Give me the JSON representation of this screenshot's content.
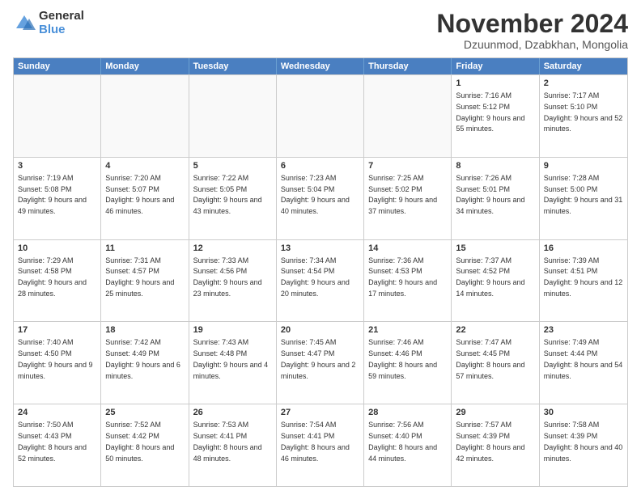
{
  "logo": {
    "general": "General",
    "blue": "Blue"
  },
  "header": {
    "month": "November 2024",
    "location": "Dzuunmod, Dzabkhan, Mongolia"
  },
  "weekdays": [
    "Sunday",
    "Monday",
    "Tuesday",
    "Wednesday",
    "Thursday",
    "Friday",
    "Saturday"
  ],
  "rows": [
    [
      {
        "day": "",
        "sunrise": "",
        "sunset": "",
        "daylight": "",
        "empty": true
      },
      {
        "day": "",
        "sunrise": "",
        "sunset": "",
        "daylight": "",
        "empty": true
      },
      {
        "day": "",
        "sunrise": "",
        "sunset": "",
        "daylight": "",
        "empty": true
      },
      {
        "day": "",
        "sunrise": "",
        "sunset": "",
        "daylight": "",
        "empty": true
      },
      {
        "day": "",
        "sunrise": "",
        "sunset": "",
        "daylight": "",
        "empty": true
      },
      {
        "day": "1",
        "sunrise": "Sunrise: 7:16 AM",
        "sunset": "Sunset: 5:12 PM",
        "daylight": "Daylight: 9 hours and 55 minutes.",
        "empty": false
      },
      {
        "day": "2",
        "sunrise": "Sunrise: 7:17 AM",
        "sunset": "Sunset: 5:10 PM",
        "daylight": "Daylight: 9 hours and 52 minutes.",
        "empty": false
      }
    ],
    [
      {
        "day": "3",
        "sunrise": "Sunrise: 7:19 AM",
        "sunset": "Sunset: 5:08 PM",
        "daylight": "Daylight: 9 hours and 49 minutes.",
        "empty": false
      },
      {
        "day": "4",
        "sunrise": "Sunrise: 7:20 AM",
        "sunset": "Sunset: 5:07 PM",
        "daylight": "Daylight: 9 hours and 46 minutes.",
        "empty": false
      },
      {
        "day": "5",
        "sunrise": "Sunrise: 7:22 AM",
        "sunset": "Sunset: 5:05 PM",
        "daylight": "Daylight: 9 hours and 43 minutes.",
        "empty": false
      },
      {
        "day": "6",
        "sunrise": "Sunrise: 7:23 AM",
        "sunset": "Sunset: 5:04 PM",
        "daylight": "Daylight: 9 hours and 40 minutes.",
        "empty": false
      },
      {
        "day": "7",
        "sunrise": "Sunrise: 7:25 AM",
        "sunset": "Sunset: 5:02 PM",
        "daylight": "Daylight: 9 hours and 37 minutes.",
        "empty": false
      },
      {
        "day": "8",
        "sunrise": "Sunrise: 7:26 AM",
        "sunset": "Sunset: 5:01 PM",
        "daylight": "Daylight: 9 hours and 34 minutes.",
        "empty": false
      },
      {
        "day": "9",
        "sunrise": "Sunrise: 7:28 AM",
        "sunset": "Sunset: 5:00 PM",
        "daylight": "Daylight: 9 hours and 31 minutes.",
        "empty": false
      }
    ],
    [
      {
        "day": "10",
        "sunrise": "Sunrise: 7:29 AM",
        "sunset": "Sunset: 4:58 PM",
        "daylight": "Daylight: 9 hours and 28 minutes.",
        "empty": false
      },
      {
        "day": "11",
        "sunrise": "Sunrise: 7:31 AM",
        "sunset": "Sunset: 4:57 PM",
        "daylight": "Daylight: 9 hours and 25 minutes.",
        "empty": false
      },
      {
        "day": "12",
        "sunrise": "Sunrise: 7:33 AM",
        "sunset": "Sunset: 4:56 PM",
        "daylight": "Daylight: 9 hours and 23 minutes.",
        "empty": false
      },
      {
        "day": "13",
        "sunrise": "Sunrise: 7:34 AM",
        "sunset": "Sunset: 4:54 PM",
        "daylight": "Daylight: 9 hours and 20 minutes.",
        "empty": false
      },
      {
        "day": "14",
        "sunrise": "Sunrise: 7:36 AM",
        "sunset": "Sunset: 4:53 PM",
        "daylight": "Daylight: 9 hours and 17 minutes.",
        "empty": false
      },
      {
        "day": "15",
        "sunrise": "Sunrise: 7:37 AM",
        "sunset": "Sunset: 4:52 PM",
        "daylight": "Daylight: 9 hours and 14 minutes.",
        "empty": false
      },
      {
        "day": "16",
        "sunrise": "Sunrise: 7:39 AM",
        "sunset": "Sunset: 4:51 PM",
        "daylight": "Daylight: 9 hours and 12 minutes.",
        "empty": false
      }
    ],
    [
      {
        "day": "17",
        "sunrise": "Sunrise: 7:40 AM",
        "sunset": "Sunset: 4:50 PM",
        "daylight": "Daylight: 9 hours and 9 minutes.",
        "empty": false
      },
      {
        "day": "18",
        "sunrise": "Sunrise: 7:42 AM",
        "sunset": "Sunset: 4:49 PM",
        "daylight": "Daylight: 9 hours and 6 minutes.",
        "empty": false
      },
      {
        "day": "19",
        "sunrise": "Sunrise: 7:43 AM",
        "sunset": "Sunset: 4:48 PM",
        "daylight": "Daylight: 9 hours and 4 minutes.",
        "empty": false
      },
      {
        "day": "20",
        "sunrise": "Sunrise: 7:45 AM",
        "sunset": "Sunset: 4:47 PM",
        "daylight": "Daylight: 9 hours and 2 minutes.",
        "empty": false
      },
      {
        "day": "21",
        "sunrise": "Sunrise: 7:46 AM",
        "sunset": "Sunset: 4:46 PM",
        "daylight": "Daylight: 8 hours and 59 minutes.",
        "empty": false
      },
      {
        "day": "22",
        "sunrise": "Sunrise: 7:47 AM",
        "sunset": "Sunset: 4:45 PM",
        "daylight": "Daylight: 8 hours and 57 minutes.",
        "empty": false
      },
      {
        "day": "23",
        "sunrise": "Sunrise: 7:49 AM",
        "sunset": "Sunset: 4:44 PM",
        "daylight": "Daylight: 8 hours and 54 minutes.",
        "empty": false
      }
    ],
    [
      {
        "day": "24",
        "sunrise": "Sunrise: 7:50 AM",
        "sunset": "Sunset: 4:43 PM",
        "daylight": "Daylight: 8 hours and 52 minutes.",
        "empty": false
      },
      {
        "day": "25",
        "sunrise": "Sunrise: 7:52 AM",
        "sunset": "Sunset: 4:42 PM",
        "daylight": "Daylight: 8 hours and 50 minutes.",
        "empty": false
      },
      {
        "day": "26",
        "sunrise": "Sunrise: 7:53 AM",
        "sunset": "Sunset: 4:41 PM",
        "daylight": "Daylight: 8 hours and 48 minutes.",
        "empty": false
      },
      {
        "day": "27",
        "sunrise": "Sunrise: 7:54 AM",
        "sunset": "Sunset: 4:41 PM",
        "daylight": "Daylight: 8 hours and 46 minutes.",
        "empty": false
      },
      {
        "day": "28",
        "sunrise": "Sunrise: 7:56 AM",
        "sunset": "Sunset: 4:40 PM",
        "daylight": "Daylight: 8 hours and 44 minutes.",
        "empty": false
      },
      {
        "day": "29",
        "sunrise": "Sunrise: 7:57 AM",
        "sunset": "Sunset: 4:39 PM",
        "daylight": "Daylight: 8 hours and 42 minutes.",
        "empty": false
      },
      {
        "day": "30",
        "sunrise": "Sunrise: 7:58 AM",
        "sunset": "Sunset: 4:39 PM",
        "daylight": "Daylight: 8 hours and 40 minutes.",
        "empty": false
      }
    ]
  ]
}
